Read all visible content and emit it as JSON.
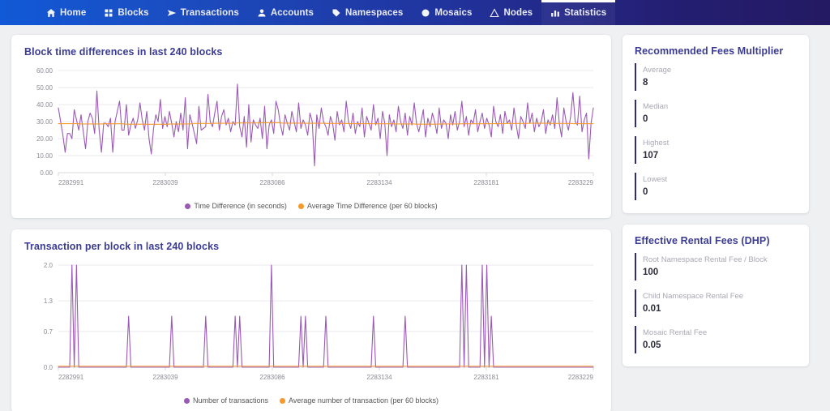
{
  "navbar": {
    "items": [
      {
        "label": "Home",
        "icon": "home-icon",
        "active": false
      },
      {
        "label": "Blocks",
        "icon": "blocks-icon",
        "active": false
      },
      {
        "label": "Transactions",
        "icon": "send-icon",
        "active": false
      },
      {
        "label": "Accounts",
        "icon": "account-icon",
        "active": false
      },
      {
        "label": "Namespaces",
        "icon": "tag-icon",
        "active": false
      },
      {
        "label": "Mosaics",
        "icon": "mosaic-icon",
        "active": false
      },
      {
        "label": "Nodes",
        "icon": "node-icon",
        "active": false
      },
      {
        "label": "Statistics",
        "icon": "bar-chart-icon",
        "active": true
      }
    ]
  },
  "colors": {
    "series_purple": "#9b59b6",
    "series_orange": "#f5992b",
    "title_navy": "#3b3b93",
    "accent_bar": "#2b2b7a",
    "page_bg": "#eff0f2",
    "card_bg": "#ffffff"
  },
  "cards": {
    "block_time": {
      "title": "Block time differences in last 240 blocks"
    },
    "tx_per_block": {
      "title": "Transaction per block in last 240 blocks"
    }
  },
  "fees_multiplier": {
    "title": "Recommended Fees Multiplier",
    "stats": [
      {
        "label": "Average",
        "value": "8"
      },
      {
        "label": "Median",
        "value": "0"
      },
      {
        "label": "Highest",
        "value": "107"
      },
      {
        "label": "Lowest",
        "value": "0"
      }
    ]
  },
  "rental_fees": {
    "title": "Effective Rental Fees (DHP)",
    "stats": [
      {
        "label": "Root Namespace Rental Fee / Block",
        "value": "100"
      },
      {
        "label": "Child Namespace Rental Fee",
        "value": "0.01"
      },
      {
        "label": "Mosaic Rental Fee",
        "value": "0.05"
      }
    ]
  },
  "chart_data": [
    {
      "id": "block-time-differences",
      "type": "line",
      "title": "Block time differences in last 240 blocks",
      "xlabel": "",
      "ylabel": "",
      "ylim": [
        0,
        60
      ],
      "yticks": [
        "0.00",
        "10.00",
        "20.00",
        "30.00",
        "40.00",
        "50.00",
        "60.00"
      ],
      "ytick_values": [
        0,
        10,
        20,
        30,
        40,
        50,
        60
      ],
      "xticks": [
        "2282991",
        "2283039",
        "2283086",
        "2283134",
        "2283181",
        "2283229"
      ],
      "xtick_values": [
        2282991,
        2283039,
        2283086,
        2283134,
        2283181,
        2283229
      ],
      "grid": true,
      "legend_position": "bottom",
      "series": [
        {
          "name": "Time Difference (in seconds)",
          "color": "#9b59b6",
          "values": [
            38,
            30,
            22,
            12,
            23,
            23,
            20,
            37,
            31,
            25,
            34,
            24,
            14,
            30,
            35,
            32,
            23,
            48,
            25,
            12,
            29,
            29,
            27,
            32,
            12,
            30,
            36,
            42,
            25,
            25,
            40,
            22,
            28,
            32,
            26,
            31,
            41,
            31,
            25,
            36,
            20,
            11,
            26,
            34,
            30,
            43,
            26,
            33,
            27,
            36,
            29,
            21,
            30,
            24,
            35,
            25,
            44,
            14,
            34,
            29,
            23,
            17,
            39,
            25,
            26,
            27,
            46,
            30,
            27,
            35,
            42,
            25,
            33,
            37,
            28,
            32,
            24,
            30,
            28,
            52,
            27,
            21,
            33,
            15,
            40,
            18,
            31,
            28,
            26,
            32,
            20,
            39,
            14,
            28,
            31,
            23,
            42,
            37,
            28,
            22,
            34,
            29,
            25,
            36,
            30,
            24,
            41,
            26,
            31,
            28,
            22,
            35,
            30,
            4,
            34,
            26,
            38,
            30,
            27,
            22,
            33,
            29,
            19,
            36,
            28,
            31,
            24,
            42,
            30,
            26,
            35,
            23,
            30,
            27,
            38,
            21,
            33,
            29,
            25,
            40,
            28,
            32,
            20,
            36,
            29,
            10,
            34,
            27,
            31,
            24,
            39,
            30,
            26,
            35,
            22,
            33,
            28,
            41,
            29,
            24,
            30,
            37,
            21,
            32,
            27,
            35,
            30,
            23,
            38,
            26,
            31,
            29,
            20,
            34,
            28,
            36,
            25,
            30,
            42,
            27,
            33,
            22,
            31,
            29,
            37,
            24,
            30,
            35,
            26,
            32,
            28,
            21,
            39,
            30,
            27,
            34,
            23,
            36,
            29,
            31,
            25,
            38,
            28,
            20,
            33,
            30,
            26,
            41,
            29,
            35,
            24,
            32,
            27,
            30,
            37,
            23,
            31,
            28,
            34,
            26,
            44,
            29,
            21,
            38,
            30,
            25,
            33,
            47,
            30,
            28,
            45,
            24,
            31,
            35,
            8,
            29,
            38
          ]
        },
        {
          "name": "Average Time Difference (per 60 blocks)",
          "color": "#f5992b",
          "values": [
            28.8,
            28.8,
            28.8,
            28.8,
            28.8,
            28.8,
            28.8,
            28.8,
            28.8,
            28.8,
            28.6,
            28.6,
            28.6,
            28.6,
            28.6,
            28.6,
            28.6,
            28.6,
            28.6,
            28.6,
            28.7,
            28.7,
            28.7,
            28.7,
            28.7,
            28.7,
            28.7,
            28.7,
            28.7,
            28.7,
            28.5,
            28.5,
            28.5,
            28.5,
            28.5,
            28.5,
            28.5,
            28.5,
            28.5,
            28.5,
            28.4,
            28.4,
            28.4,
            28.4,
            28.4,
            28.4,
            28.4,
            28.4,
            28.4,
            28.4,
            28.6,
            28.6,
            28.6,
            28.6,
            28.6,
            28.6,
            28.6,
            28.6,
            28.6,
            28.6,
            28.9,
            28.9,
            28.9,
            28.9,
            28.9,
            28.9,
            28.9,
            28.9,
            28.9,
            28.9,
            29.0,
            29.0,
            29.0,
            29.0,
            29.0,
            29.0,
            29.0,
            29.0,
            29.0,
            29.0,
            29.2,
            29.2,
            29.2,
            29.2,
            29.2,
            29.2,
            29.2,
            29.2,
            29.2,
            29.2,
            29.3,
            29.3,
            29.3,
            29.3,
            29.3,
            29.3,
            29.3,
            29.3,
            29.3,
            29.3,
            29.1,
            29.1,
            29.1,
            29.1,
            29.1,
            29.1,
            29.1,
            29.1,
            29.1,
            29.1,
            29.0,
            29.0,
            29.0,
            29.0,
            29.0,
            29.0,
            29.0,
            29.0,
            29.0,
            29.0,
            28.9,
            28.9,
            28.9,
            28.9,
            28.9,
            28.9,
            28.9,
            28.9,
            28.9,
            28.9,
            28.8,
            28.8,
            28.8,
            28.8,
            28.8,
            28.8,
            28.8,
            28.8,
            28.8,
            28.8,
            28.7,
            28.7,
            28.7,
            28.7,
            28.7,
            28.7,
            28.7,
            28.7,
            28.7,
            28.7,
            28.6,
            28.6,
            28.6,
            28.6,
            28.6,
            28.6,
            28.6,
            28.6,
            28.6,
            28.6,
            28.5,
            28.5,
            28.5,
            28.5,
            28.5,
            28.5,
            28.5,
            28.5,
            28.5,
            28.5,
            28.6,
            28.6,
            28.6,
            28.6,
            28.6,
            28.6,
            28.6,
            28.6,
            28.6,
            28.6,
            28.7,
            28.7,
            28.7,
            28.7,
            28.7,
            28.7,
            28.7,
            28.7,
            28.7,
            28.7,
            28.8,
            28.8,
            28.8,
            28.8,
            28.8,
            28.8,
            28.8,
            28.8,
            28.8,
            28.8,
            28.9,
            28.9,
            28.9,
            28.9,
            28.9,
            28.9,
            28.9,
            28.9,
            28.9,
            28.9,
            29.0,
            29.0,
            29.0,
            29.0,
            29.0,
            29.0,
            29.0,
            29.0,
            29.0,
            29.0,
            28.9,
            28.9,
            28.9,
            28.9,
            28.9,
            28.9,
            28.9,
            28.9,
            28.9,
            28.9,
            28.8,
            28.8,
            28.8,
            28.8,
            28.8,
            28.8,
            28.8,
            28.8,
            28.8,
            28.8
          ]
        }
      ]
    },
    {
      "id": "transactions-per-block",
      "type": "line",
      "title": "Transaction per block in last 240 blocks",
      "xlabel": "",
      "ylabel": "",
      "ylim": [
        0,
        2
      ],
      "yticks": [
        "0.0",
        "0.7",
        "1.3",
        "2.0"
      ],
      "ytick_values": [
        0,
        0.7,
        1.3,
        2.0
      ],
      "xticks": [
        "2282991",
        "2283039",
        "2283086",
        "2283134",
        "2283181",
        "2283229"
      ],
      "xtick_values": [
        2282991,
        2283039,
        2283086,
        2283134,
        2283181,
        2283229
      ],
      "grid": true,
      "legend_position": "bottom",
      "series": [
        {
          "name": "Number of transactions",
          "color": "#9b59b6",
          "values": [
            0,
            0,
            0,
            0,
            0,
            0,
            2,
            0,
            2,
            0,
            0,
            0,
            0,
            0,
            0,
            0,
            0,
            0,
            0,
            0,
            0,
            0,
            0,
            0,
            0,
            0,
            0,
            0,
            0,
            0,
            0,
            1,
            0,
            0,
            0,
            0,
            0,
            0,
            0,
            0,
            0,
            0,
            0,
            0,
            0,
            0,
            0,
            0,
            0,
            0,
            1,
            0,
            0,
            0,
            0,
            0,
            0,
            0,
            0,
            0,
            0,
            0,
            0,
            0,
            0,
            1,
            0,
            0,
            0,
            0,
            0,
            0,
            0,
            0,
            0,
            0,
            0,
            0,
            1,
            0,
            1,
            0,
            0,
            0,
            0,
            0,
            0,
            0,
            0,
            0,
            0,
            0,
            0,
            0,
            2,
            0,
            0,
            0,
            0,
            0,
            0,
            0,
            0,
            0,
            0,
            0,
            0,
            1,
            0,
            1,
            0,
            0,
            0,
            0,
            0,
            0,
            0,
            0,
            1,
            0,
            0,
            0,
            0,
            0,
            0,
            0,
            0,
            0,
            0,
            0,
            0,
            0,
            0,
            0,
            0,
            0,
            0,
            0,
            0,
            1,
            0,
            0,
            0,
            0,
            0,
            0,
            0,
            0,
            0,
            0,
            0,
            0,
            0,
            1,
            0,
            0,
            0,
            0,
            0,
            0,
            0,
            0,
            0,
            0,
            0,
            0,
            0,
            0,
            0,
            0,
            0,
            0,
            0,
            0,
            0,
            0,
            0,
            0,
            2,
            0,
            2,
            0,
            0,
            0,
            0,
            0,
            0,
            2,
            0,
            2,
            0,
            1,
            0,
            0,
            0,
            0,
            0,
            0,
            0,
            0,
            0,
            0,
            0,
            0,
            0,
            0,
            0,
            0,
            0,
            0,
            0,
            0,
            0,
            0,
            0,
            0,
            0,
            0,
            0,
            0,
            0,
            0,
            0,
            0,
            0,
            0,
            0,
            0,
            0,
            0,
            0,
            0,
            0,
            0,
            0,
            0,
            0
          ]
        },
        {
          "name": "Average number of transaction (per 60 blocks)",
          "color": "#f5992b",
          "values": [
            0.02,
            0.02,
            0.02,
            0.02,
            0.02,
            0.02,
            0.02,
            0.02,
            0.02,
            0.02,
            0.02,
            0.02,
            0.02,
            0.02,
            0.02,
            0.02,
            0.02,
            0.02,
            0.02,
            0.02,
            0.02,
            0.02,
            0.02,
            0.02,
            0.02,
            0.02,
            0.02,
            0.02,
            0.02,
            0.02,
            0.02,
            0.02,
            0.02,
            0.02,
            0.02,
            0.02,
            0.02,
            0.02,
            0.02,
            0.02,
            0.02,
            0.02,
            0.02,
            0.02,
            0.02,
            0.02,
            0.02,
            0.02,
            0.02,
            0.02,
            0.02,
            0.02,
            0.02,
            0.02,
            0.02,
            0.02,
            0.02,
            0.02,
            0.02,
            0.02,
            0.02,
            0.02,
            0.02,
            0.02,
            0.02,
            0.02,
            0.02,
            0.02,
            0.02,
            0.02,
            0.02,
            0.02,
            0.02,
            0.02,
            0.02,
            0.02,
            0.02,
            0.02,
            0.02,
            0.02,
            0.02,
            0.02,
            0.02,
            0.02,
            0.02,
            0.02,
            0.02,
            0.02,
            0.02,
            0.02,
            0.02,
            0.02,
            0.02,
            0.02,
            0.02,
            0.02,
            0.02,
            0.02,
            0.02,
            0.02,
            0.02,
            0.02,
            0.02,
            0.02,
            0.02,
            0.02,
            0.02,
            0.02,
            0.02,
            0.02,
            0.02,
            0.02,
            0.02,
            0.02,
            0.02,
            0.02,
            0.02,
            0.02,
            0.02,
            0.02,
            0.02,
            0.02,
            0.02,
            0.02,
            0.02,
            0.02,
            0.02,
            0.02,
            0.02,
            0.02,
            0.02,
            0.02,
            0.02,
            0.02,
            0.02,
            0.02,
            0.02,
            0.02,
            0.02,
            0.02,
            0.02,
            0.02,
            0.02,
            0.02,
            0.02,
            0.02,
            0.02,
            0.02,
            0.02,
            0.02,
            0.02,
            0.02,
            0.02,
            0.02,
            0.02,
            0.02,
            0.02,
            0.02,
            0.02,
            0.02,
            0.02,
            0.02,
            0.02,
            0.02,
            0.02,
            0.02,
            0.02,
            0.02,
            0.02,
            0.02,
            0.02,
            0.02,
            0.02,
            0.02,
            0.02,
            0.02,
            0.02,
            0.02,
            0.02,
            0.02,
            0.02,
            0.02,
            0.02,
            0.02,
            0.02,
            0.02,
            0.02,
            0.02,
            0.02,
            0.02,
            0.02,
            0.02,
            0.02,
            0.02,
            0.02,
            0.02,
            0.02,
            0.02,
            0.02,
            0.02,
            0.02,
            0.02,
            0.02,
            0.02,
            0.02,
            0.02,
            0.02,
            0.02,
            0.02,
            0.02,
            0.02,
            0.02,
            0.02,
            0.02,
            0.02,
            0.02,
            0.02,
            0.02,
            0.02,
            0.02,
            0.02,
            0.02,
            0.02,
            0.02,
            0.02,
            0.02,
            0.02
          ]
        }
      ]
    }
  ]
}
